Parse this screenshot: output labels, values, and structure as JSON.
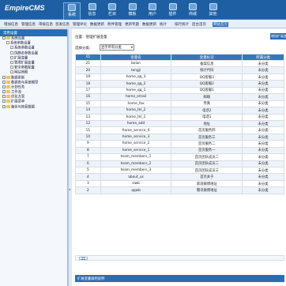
{
  "app": {
    "logo": "EmpireCMS"
  },
  "topnav": [
    "系统",
    "信息",
    "栏目",
    "模板",
    "用户",
    "插件",
    "商城",
    "其他"
  ],
  "subnav": [
    "增加信息",
    "管理信息",
    "审核信息",
    "签发信息",
    "管理评论",
    "数据更新",
    "附件管理",
    "更新专题",
    "数据更新",
    "统计",
    "排行统计",
    "后台首页",
    "网站首页"
  ],
  "sidebar": {
    "title": "常用设置",
    "tree": [
      {
        "label": "系统设置",
        "level": 0,
        "type": "folder"
      },
      {
        "label": "系统参数设置",
        "level": 1,
        "type": "page"
      },
      {
        "label": "系统参数设置",
        "level": 2,
        "type": "page"
      },
      {
        "label": "伪静态参数设置",
        "level": 2,
        "type": "page"
      },
      {
        "label": "扩展变量",
        "level": 2,
        "type": "page"
      },
      {
        "label": "管理扩展变量",
        "level": 2,
        "type": "page"
      },
      {
        "label": "安全参数配置",
        "level": 2,
        "type": "page"
      },
      {
        "label": "网站地图",
        "level": 2,
        "type": "page"
      },
      {
        "label": "数据更新",
        "level": 0,
        "type": "folder"
      },
      {
        "label": "数据表与系统模型",
        "level": 0,
        "type": "folder"
      },
      {
        "label": "计划任务",
        "level": 0,
        "type": "folder"
      },
      {
        "label": "工作流",
        "level": 0,
        "type": "folder"
      },
      {
        "label": "优化方案",
        "level": 0,
        "type": "folder"
      },
      {
        "label": "扩展菜单",
        "level": 0,
        "type": "folder"
      },
      {
        "label": "备份与恢复数据",
        "level": 0,
        "type": "folder"
      }
    ]
  },
  "main": {
    "location": "位置：管理扩展变量",
    "add_button": "增加扩展变量",
    "filter_label": "选择分类：",
    "filter_value": "显示所有分类",
    "columns": [
      "ID",
      "变量名",
      "变量标识",
      "所属分类"
    ],
    "rows": [
      [
        "21",
        "beian",
        "备案信息",
        "未分类"
      ],
      [
        "20",
        "tongji",
        "统计代码",
        "未分类"
      ],
      [
        "19",
        "home_qq_3",
        "QQ客服3",
        "未分类"
      ],
      [
        "18",
        "home_qq_2",
        "QQ客服2",
        "未分类"
      ],
      [
        "17",
        "home_qq_1",
        "QQ客服1",
        "未分类"
      ],
      [
        "16",
        "home_email",
        "邮箱",
        "未分类"
      ],
      [
        "15",
        "home_fax",
        "传真",
        "未分类"
      ],
      [
        "14",
        "home_tel_2",
        "电话2",
        "未分类"
      ],
      [
        "13",
        "home_tel_1",
        "电话1",
        "未分类"
      ],
      [
        "12",
        "home_add",
        "地址",
        "未分类"
      ],
      [
        "11",
        "home_service_4",
        "首页服务四",
        "未分类"
      ],
      [
        "10",
        "home_service_3",
        "首页服务三",
        "未分类"
      ],
      [
        "9",
        "home_service_2",
        "首页服务二",
        "未分类"
      ],
      [
        "8",
        "home_service_1",
        "首页服务一",
        "未分类"
      ],
      [
        "7",
        "team_members_1",
        "首页团队成员二",
        "未分类"
      ],
      [
        "6",
        "team_members_2",
        "首页团队成员二",
        "未分类"
      ],
      [
        "5",
        "team_members_3",
        "首页团队成员三",
        "未分类"
      ],
      [
        "4",
        "about_us",
        "首页关于",
        "未分类"
      ],
      [
        "3",
        "slwb",
        "新浪微博地址",
        "未分类"
      ],
      [
        "2",
        "qqwb",
        "腾讯微博地址",
        "未分类"
      ]
    ],
    "pager": "21",
    "footer_title": "扩展变量调用说明"
  }
}
